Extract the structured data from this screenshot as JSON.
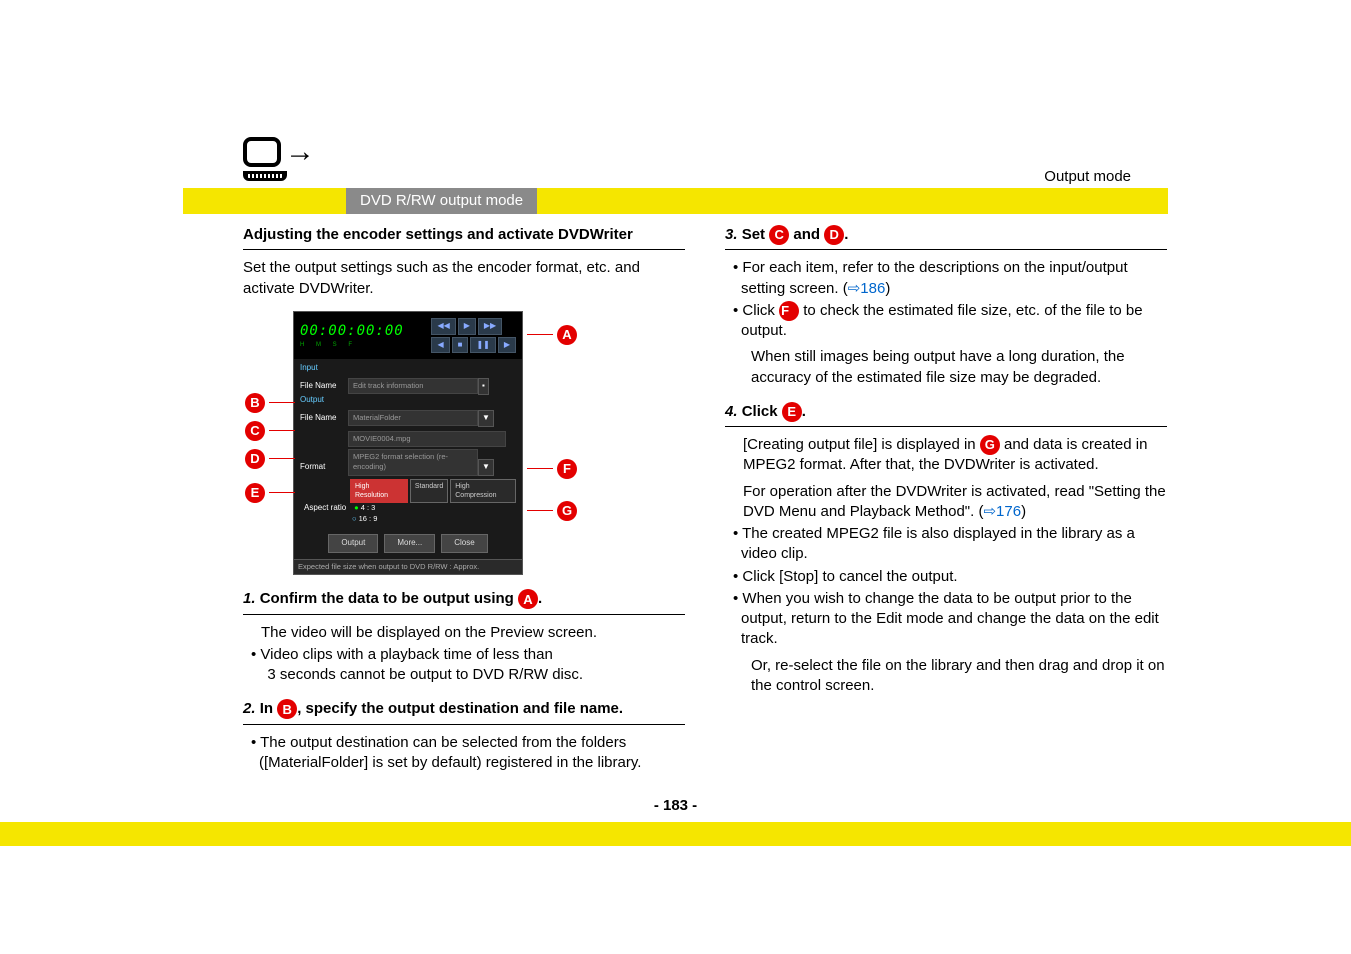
{
  "header": {
    "output_mode": "Output mode"
  },
  "tab": {
    "title": "DVD R/RW output mode"
  },
  "left": {
    "heading": "Adjusting  the encoder settings and activate DVDWriter",
    "intro": "Set the output settings such as the encoder format, etc. and activate DVDWriter.",
    "step1": {
      "num": "1.",
      "title_pre": "Confirm the data to be output using ",
      "title_post": ".",
      "body": "The video will be displayed on the Preview screen.",
      "b1a": "• Video clips with a playback time of less than",
      "b1b": "3 seconds cannot be output to DVD R/RW disc."
    },
    "step2": {
      "num": "2.",
      "title_pre": "In ",
      "title_post": ", specify the output destination and file name.",
      "b1": "• The output destination can be selected from the folders ([MaterialFolder] is set by default) registered in the library."
    }
  },
  "right": {
    "step3": {
      "num": "3.",
      "title_pre": "Set ",
      "title_mid": " and ",
      "title_post": ".",
      "b1": "• For each item, refer to the descriptions on the input/output setting screen. (",
      "b1_link": "186",
      "b1_close": ")",
      "b2_pre": "• Click ",
      "b2_post": " to check the estimated file size, etc. of the file to be output.",
      "b2_cont": "When still images being output have a long duration, the accuracy of the estimated file size may be degraded."
    },
    "step4": {
      "num": "4.",
      "title_pre": "Click ",
      "title_post": ".",
      "p1_pre": "[Creating output file] is displayed in ",
      "p1_post": " and data is created in MPEG2 format. After that, the DVDWriter is activated.",
      "p2": "For operation after the DVDWriter is activated, read \"Setting the DVD Menu and Playback Method\". (",
      "p2_link": "176",
      "p2_close": ")",
      "b1": "• The created MPEG2 file is also displayed in the library as a video clip.",
      "b2": "• Click [Stop] to cancel the output.",
      "b3": "• When you wish to change the data to be output prior to the output, return to the Edit mode and change the data on the edit track.",
      "b3_cont": "Or, re-select the file on the library and then drag and drop it on the control screen."
    }
  },
  "markers": {
    "A": "A",
    "B": "B",
    "C": "C",
    "D": "D",
    "E": "E",
    "F": "F",
    "G": "G"
  },
  "figure": {
    "time": "00:00:00:00",
    "time_sub": "H     M     S     F",
    "input": "Input",
    "output": "Output",
    "file_name": "File Name",
    "format": "Format",
    "aspect": "Aspect ratio",
    "edit_track": "Edit track information",
    "material": "MaterialFolder",
    "movie": "MOVIE0004.mpg",
    "mpeg2": "MPEG2 format selection (re-encoding)",
    "q_high": "High Resolution",
    "q_std": "Standard",
    "q_comp": "High Compression",
    "r43": "4 : 3",
    "r169": "16 : 9",
    "btn_output": "Output",
    "btn_more": "More...",
    "btn_close": "Close",
    "status": "Expected file size when output to DVD R/RW : Approx."
  },
  "page_number": "- 183 -",
  "arrow": "⇨"
}
